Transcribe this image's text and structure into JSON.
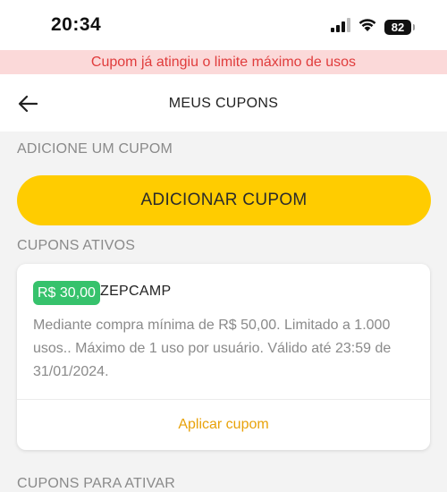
{
  "status_bar": {
    "time": "20:34",
    "battery": "82"
  },
  "banner": {
    "message": "Cupom já atingiu o limite máximo de usos"
  },
  "header": {
    "title": "MEUS CUPONS"
  },
  "add_section": {
    "label": "ADICIONE UM CUPOM",
    "button_label": "ADICIONAR CUPOM"
  },
  "active_section": {
    "label": "CUPONS ATIVOS",
    "coupons": [
      {
        "value": "R$ 30,00",
        "code": "ZEPCAMP",
        "description": "Mediante compra mínima de R$ 50,00. Limitado a 1.000 usos.. Máximo de 1 uso por usuário. Válido até 23:59 de 31/01/2024.",
        "action_label": "Aplicar cupom"
      }
    ]
  },
  "next_section": {
    "label": "CUPONS PARA ATIVAR"
  },
  "colors": {
    "accent": "#ffcc00",
    "badge": "#36c26c",
    "banner_bg": "#fbd9d9",
    "banner_text": "#e03c3c",
    "link": "#e8a20a"
  }
}
